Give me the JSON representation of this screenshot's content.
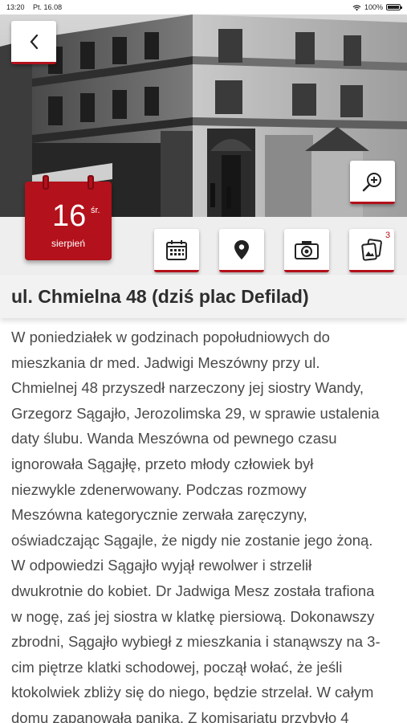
{
  "status_bar": {
    "time": "13:20",
    "date": "Pt. 16.08",
    "battery": "100%",
    "battery_level": 1.0
  },
  "hero": {
    "image_alt": "historic-tenement-corner-photo"
  },
  "nav": {
    "back_icon": "chevron-left-icon",
    "zoom_icon": "zoom-in-icon"
  },
  "date": {
    "day": "16",
    "weekday": "śr.",
    "month": "sierpień"
  },
  "actions": [
    {
      "icon": "calendar-icon"
    },
    {
      "icon": "map-pin-icon"
    },
    {
      "icon": "camera-icon"
    },
    {
      "icon": "gallery-icon",
      "badge": "3"
    }
  ],
  "title": "ul. Chmielna 48 (dziś plac Defilad)",
  "article": {
    "lines": [
      "W poniedziałek w godzinach popołudniowych do",
      "mieszkania dr med. Jadwigi Meszówny przy ul.",
      "Chmielnej 48 przyszedł narzeczony jej siostry Wandy,",
      "Grzegorz Sągajło, Jerozolimska 29, w sprawie ustalenia",
      "daty ślubu. Wanda Meszówna od pewnego czasu",
      "ignorowała Sągajłę, przeto młody człowiek był",
      "niezwykle zdenerwowany. Podczas rozmowy",
      "Meszówna kategorycznie zerwała zaręczyny,",
      "oświadczając Sągajle, że nigdy nie zostanie jego żoną.",
      "W odpowiedzi Sągajło wyjął rewolwer i strzelił",
      "dwukrotnie do kobiet. Dr Jadwiga Mesz została trafiona",
      "w nogę, zaś jej siostra w klatkę piersiową. Dokonawszy",
      "zbrodni, Sągajło wybiegł z mieszkania i stanąwszy na 3-",
      "cim piętrze klatki schodowej, począł wołać, że jeśli",
      "ktokolwiek zbliży się do niego, będzie strzelał. W całym",
      "domu zapanowała panika. Z komisariatu przybyło 4"
    ]
  },
  "colors": {
    "accent": "#b3111b",
    "bar_bg": "#eeeeee",
    "text": "#4a4a4a"
  }
}
